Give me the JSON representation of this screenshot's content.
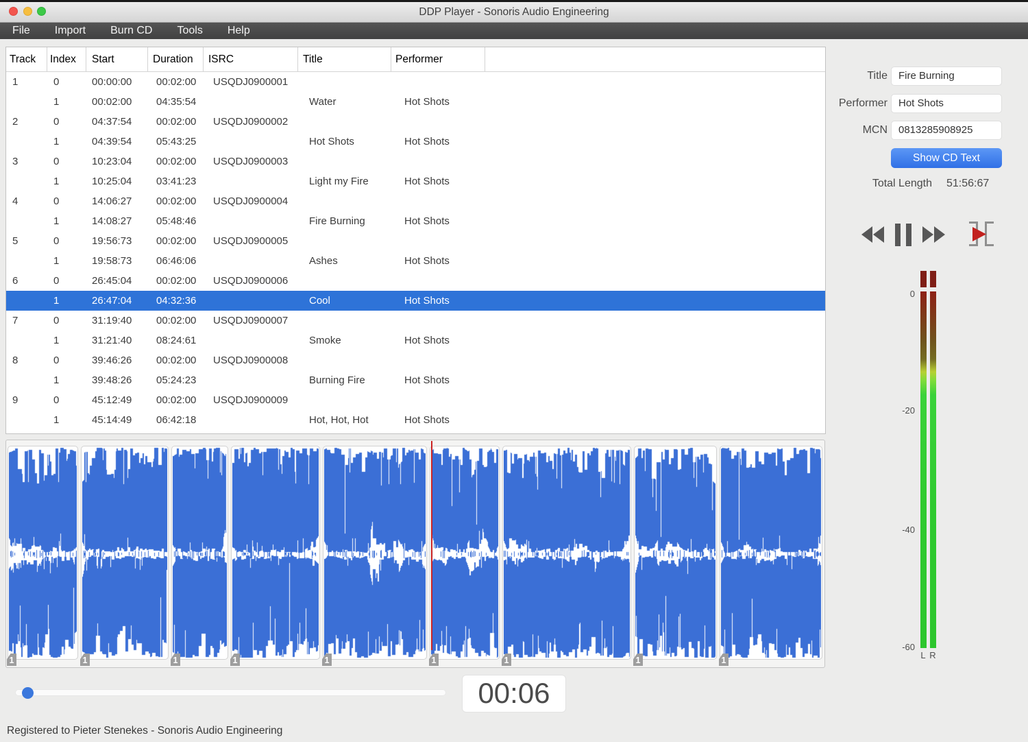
{
  "window": {
    "title": "DDP Player - Sonoris Audio Engineering"
  },
  "menu": {
    "items": [
      "File",
      "Import",
      "Burn CD",
      "Tools",
      "Help"
    ]
  },
  "table": {
    "columns": [
      "Track",
      "Index",
      "Start",
      "Duration",
      "ISRC",
      "Title",
      "Performer"
    ],
    "rows": [
      {
        "track": "1",
        "index": "0",
        "start": "00:00:00",
        "duration": "00:02:00",
        "isrc": "USQDJ0900001",
        "title": "",
        "performer": "",
        "selected": false
      },
      {
        "track": "",
        "index": "1",
        "start": "00:02:00",
        "duration": "04:35:54",
        "isrc": "",
        "title": "Water",
        "performer": "Hot Shots",
        "selected": false
      },
      {
        "track": "2",
        "index": "0",
        "start": "04:37:54",
        "duration": "00:02:00",
        "isrc": "USQDJ0900002",
        "title": "",
        "performer": "",
        "selected": false
      },
      {
        "track": "",
        "index": "1",
        "start": "04:39:54",
        "duration": "05:43:25",
        "isrc": "",
        "title": "Hot Shots",
        "performer": "Hot Shots",
        "selected": false
      },
      {
        "track": "3",
        "index": "0",
        "start": "10:23:04",
        "duration": "00:02:00",
        "isrc": "USQDJ0900003",
        "title": "",
        "performer": "",
        "selected": false
      },
      {
        "track": "",
        "index": "1",
        "start": "10:25:04",
        "duration": "03:41:23",
        "isrc": "",
        "title": "Light my Fire",
        "performer": "Hot Shots",
        "selected": false
      },
      {
        "track": "4",
        "index": "0",
        "start": "14:06:27",
        "duration": "00:02:00",
        "isrc": "USQDJ0900004",
        "title": "",
        "performer": "",
        "selected": false
      },
      {
        "track": "",
        "index": "1",
        "start": "14:08:27",
        "duration": "05:48:46",
        "isrc": "",
        "title": "Fire Burning",
        "performer": "Hot Shots",
        "selected": false
      },
      {
        "track": "5",
        "index": "0",
        "start": "19:56:73",
        "duration": "00:02:00",
        "isrc": "USQDJ0900005",
        "title": "",
        "performer": "",
        "selected": false
      },
      {
        "track": "",
        "index": "1",
        "start": "19:58:73",
        "duration": "06:46:06",
        "isrc": "",
        "title": "Ashes",
        "performer": "Hot Shots",
        "selected": false
      },
      {
        "track": "6",
        "index": "0",
        "start": "26:45:04",
        "duration": "00:02:00",
        "isrc": "USQDJ0900006",
        "title": "",
        "performer": "",
        "selected": false
      },
      {
        "track": "",
        "index": "1",
        "start": "26:47:04",
        "duration": "04:32:36",
        "isrc": "",
        "title": "Cool",
        "performer": "Hot Shots",
        "selected": true
      },
      {
        "track": "7",
        "index": "0",
        "start": "31:19:40",
        "duration": "00:02:00",
        "isrc": "USQDJ0900007",
        "title": "",
        "performer": "",
        "selected": false
      },
      {
        "track": "",
        "index": "1",
        "start": "31:21:40",
        "duration": "08:24:61",
        "isrc": "",
        "title": "Smoke",
        "performer": "Hot Shots",
        "selected": false
      },
      {
        "track": "8",
        "index": "0",
        "start": "39:46:26",
        "duration": "00:02:00",
        "isrc": "USQDJ0900008",
        "title": "",
        "performer": "",
        "selected": false
      },
      {
        "track": "",
        "index": "1",
        "start": "39:48:26",
        "duration": "05:24:23",
        "isrc": "",
        "title": "Burning Fire",
        "performer": "Hot Shots",
        "selected": false
      },
      {
        "track": "9",
        "index": "0",
        "start": "45:12:49",
        "duration": "00:02:00",
        "isrc": "USQDJ0900009",
        "title": "",
        "performer": "",
        "selected": false
      },
      {
        "track": "",
        "index": "1",
        "start": "45:14:49",
        "duration": "06:42:18",
        "isrc": "",
        "title": "Hot, Hot, Hot",
        "performer": "Hot Shots",
        "selected": false
      }
    ]
  },
  "side": {
    "title_label": "Title",
    "title_value": "Fire Burning",
    "performer_label": "Performer",
    "performer_value": "Hot Shots",
    "mcn_label": "MCN",
    "mcn_value": "0813285908925",
    "cd_text_button": "Show CD Text",
    "total_label": "Total Length",
    "total_value": "51:56:67"
  },
  "meter": {
    "scale_labels": [
      "0",
      "-20",
      "-40",
      "-60"
    ],
    "channel_labels": [
      "L",
      "R"
    ]
  },
  "waveform": {
    "track_tag": "1",
    "color": "#3b6fd6"
  },
  "player": {
    "time": "00:06"
  },
  "status": {
    "text": "Registered to Pieter Stenekes - Sonoris Audio Engineering"
  }
}
